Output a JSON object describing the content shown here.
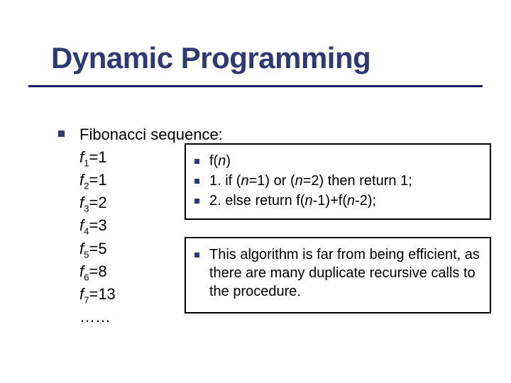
{
  "title": "Dynamic Programming",
  "seq_title": "Fibonacci sequence:",
  "fib": {
    "f1_lhs": "f",
    "f1_sub": "1",
    "f1_rhs": "=1",
    "f2_lhs": "f",
    "f2_sub": "2",
    "f2_rhs": "=1",
    "f3_lhs": "f",
    "f3_sub": "3",
    "f3_rhs": "=2",
    "f4_lhs": "f",
    "f4_sub": "4",
    "f4_rhs": "=3",
    "f5_lhs": "f",
    "f5_sub": "5",
    "f5_rhs": "=5",
    "f6_lhs": "f",
    "f6_sub": "6",
    "f6_rhs": "=8",
    "f7_lhs": "f",
    "f7_sub": "7",
    "f7_rhs": "=13",
    "ellipsis": "……"
  },
  "algo": {
    "line1_a": "f(",
    "line1_n": "n",
    "line1_b": ")",
    "line2_a": "1. if (",
    "line2_n1": "n",
    "line2_b": "=1) or (",
    "line2_n2": "n",
    "line2_c": "=2) then return 1;",
    "line3_a": "2. else return f(",
    "line3_n1": "n",
    "line3_b": "-1)+f(",
    "line3_n2": "n",
    "line3_c": "-2);"
  },
  "note": "This algorithm is far from being efficient, as there are many duplicate recursive calls to the procedure."
}
